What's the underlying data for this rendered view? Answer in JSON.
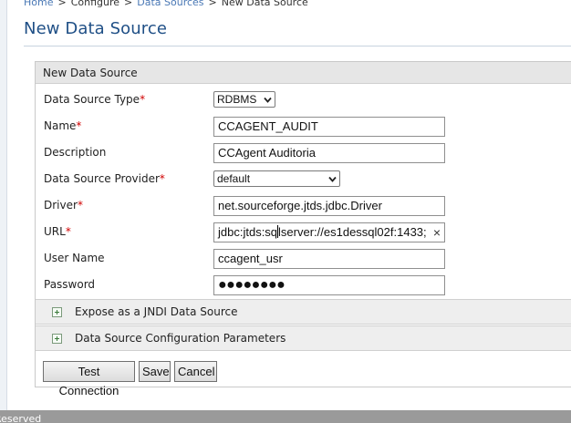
{
  "breadcrumb": {
    "items": [
      "Home",
      "Configure",
      "Data Sources",
      "New Data Source"
    ],
    "separator": ">"
  },
  "page": {
    "title": "New Data Source"
  },
  "panel": {
    "header": "New Data Source",
    "fields": {
      "type": {
        "label": "Data Source Type",
        "required_mark": "*",
        "selected": "RDBMS"
      },
      "name": {
        "label": "Name",
        "required_mark": "*",
        "value": "CCAGENT_AUDIT"
      },
      "description": {
        "label": "Description",
        "value": "CCAgent Auditoria"
      },
      "provider": {
        "label": "Data Source Provider",
        "required_mark": "*",
        "selected": "default"
      },
      "driver": {
        "label": "Driver",
        "required_mark": "*",
        "value": "net.sourceforge.jtds.jdbc.Driver"
      },
      "url": {
        "label": "URL",
        "required_mark": "*",
        "value_before_caret": "jdbc:jtds:sq",
        "value_after_caret": "lserver://es1dessql02f:1433;",
        "clear_glyph": "×"
      },
      "username": {
        "label": "User Name",
        "value": "ccagent_usr"
      },
      "password": {
        "label": "Password",
        "masked_value": "●●●●●●●●"
      }
    },
    "sections": {
      "jndi": "Expose as a JNDI Data Source",
      "config": "Data Source Configuration Parameters"
    },
    "buttons": {
      "test": "Test Connection",
      "save": "Save",
      "cancel": "Cancel"
    }
  },
  "footer": {
    "text": "Reserved"
  },
  "colors": {
    "title": "#1f4f86",
    "link": "#4a78b5",
    "required": "#d00000",
    "panel_header": "#e6e6e6",
    "footer": "#9a9a9a"
  },
  "icons": {
    "select_arrow": "chevron-down-icon",
    "section_toggle": "plus-icon",
    "clear": "close-icon"
  }
}
